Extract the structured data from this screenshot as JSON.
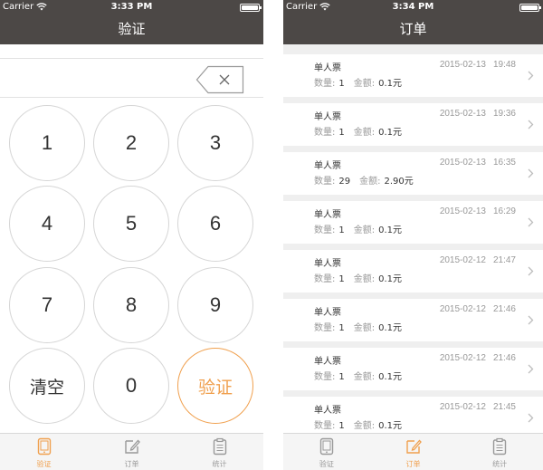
{
  "status_left": {
    "carrier": "Carrier",
    "time": "3:33 PM",
    "battery_level": 1.0
  },
  "status_right": {
    "carrier": "Carrier",
    "time": "3:34 PM",
    "battery_level": 1.0
  },
  "verify_screen": {
    "title": "验证",
    "code_value": "",
    "keys": [
      "1",
      "2",
      "3",
      "4",
      "5",
      "6",
      "7",
      "8",
      "9",
      "清空",
      "0",
      "验证"
    ]
  },
  "orders_screen": {
    "title": "订单",
    "qty_label": "数量:",
    "amount_label": "金额:",
    "orders": [
      {
        "title": "单人票",
        "date": "2015-02-13",
        "time": "19:48",
        "qty": "1",
        "amount": "0.1元"
      },
      {
        "title": "单人票",
        "date": "2015-02-13",
        "time": "19:36",
        "qty": "1",
        "amount": "0.1元"
      },
      {
        "title": "单人票",
        "date": "2015-02-13",
        "time": "16:35",
        "qty": "29",
        "amount": "2.90元"
      },
      {
        "title": "单人票",
        "date": "2015-02-13",
        "time": "16:29",
        "qty": "1",
        "amount": "0.1元"
      },
      {
        "title": "单人票",
        "date": "2015-02-12",
        "time": "21:47",
        "qty": "1",
        "amount": "0.1元"
      },
      {
        "title": "单人票",
        "date": "2015-02-12",
        "time": "21:46",
        "qty": "1",
        "amount": "0.1元"
      },
      {
        "title": "单人票",
        "date": "2015-02-12",
        "time": "21:46",
        "qty": "1",
        "amount": "0.1元"
      },
      {
        "title": "单人票",
        "date": "2015-02-12",
        "time": "21:45",
        "qty": "1",
        "amount": "0.1元"
      }
    ]
  },
  "tabs": [
    {
      "label": "验证",
      "icon": "tablet-icon"
    },
    {
      "label": "订单",
      "icon": "edit-icon"
    },
    {
      "label": "统计",
      "icon": "clipboard-icon"
    }
  ],
  "active_tab_left": 0,
  "active_tab_right": 1,
  "colors": {
    "navbar": "#4c4846",
    "accent": "#f0a04e",
    "border": "#d6d6d6",
    "list_bg": "#efefef"
  }
}
